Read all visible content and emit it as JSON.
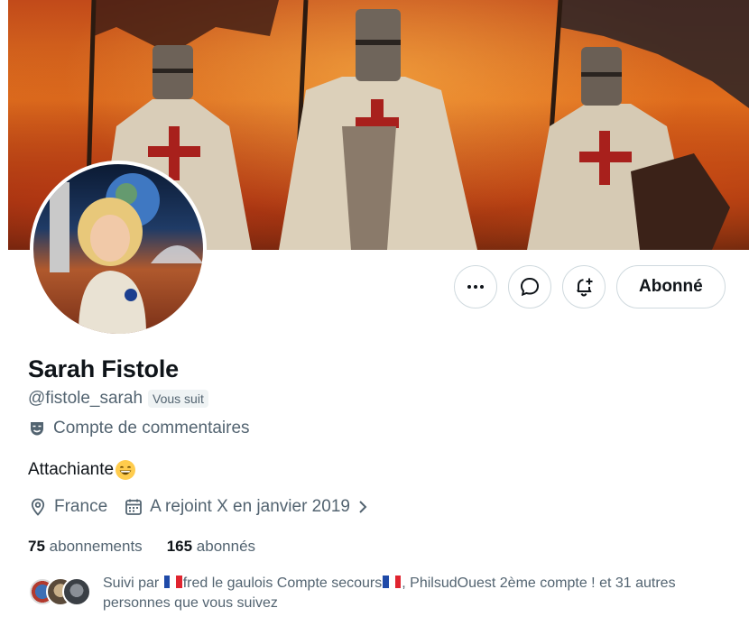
{
  "profile": {
    "display_name": "Sarah Fistole",
    "handle": "@fistole_sarah",
    "follows_you_badge": "Vous suit",
    "category": "Compte de commentaires",
    "bio": "Attachiante",
    "location": "France",
    "joined": "A rejoint X en janvier 2019"
  },
  "actions": {
    "more_icon": "more-horizontal-icon",
    "message_icon": "message-bubble-icon",
    "notify_icon": "bell-plus-icon",
    "follow_label": "Abonné"
  },
  "stats": {
    "following_count": "75",
    "following_label": "abonnements",
    "followers_count": "165",
    "followers_label": "abonnés"
  },
  "followed_by": {
    "prefix": "Suivi par",
    "name1": "fred le gaulois Compte secours",
    "separator": ",",
    "name2": "PhilsudOuest 2ème compte !",
    "suffix": "et 31 autres personnes que vous suivez"
  },
  "colors": {
    "secondary_text": "#536471",
    "border": "#cfd9de",
    "flag_blue": "#1f4aa8",
    "flag_red": "#e0242f"
  }
}
